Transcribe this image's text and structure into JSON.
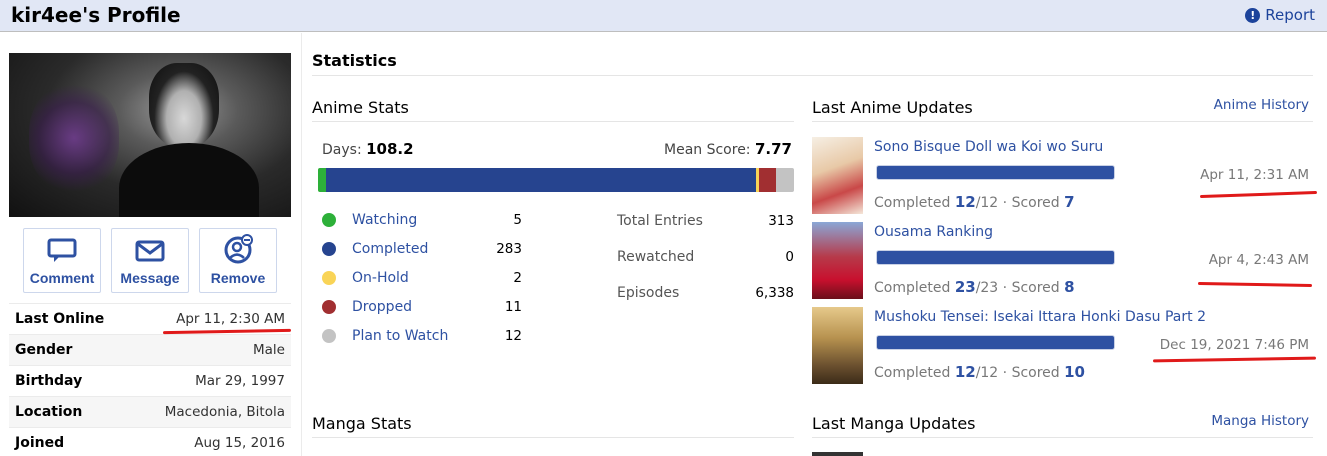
{
  "header": {
    "title": "kir4ee's Profile",
    "report_label": "Report"
  },
  "actions": [
    {
      "label": "Comment",
      "icon": "comment-icon"
    },
    {
      "label": "Message",
      "icon": "envelope-icon"
    },
    {
      "label": "Remove",
      "icon": "remove-friend-icon"
    }
  ],
  "info": [
    {
      "key": "Last Online",
      "value": "Apr 11, 2:30 AM"
    },
    {
      "key": "Gender",
      "value": "Male"
    },
    {
      "key": "Birthday",
      "value": "Mar 29, 1997"
    },
    {
      "key": "Location",
      "value": "Macedonia, Bitola"
    },
    {
      "key": "Joined",
      "value": "Aug 15, 2016"
    }
  ],
  "statistics": {
    "title": "Statistics",
    "anime_stats_title": "Anime Stats",
    "days_label": "Days:",
    "days_value": "108.2",
    "mean_label": "Mean Score:",
    "mean_value": "7.77",
    "legend": [
      {
        "name": "Watching",
        "count": "5",
        "color": "#2db039"
      },
      {
        "name": "Completed",
        "count": "283",
        "color": "#26448f"
      },
      {
        "name": "On-Hold",
        "count": "2",
        "color": "#f9d457"
      },
      {
        "name": "Dropped",
        "count": "11",
        "color": "#a12f31"
      },
      {
        "name": "Plan to Watch",
        "count": "12",
        "color": "#c3c3c3"
      }
    ],
    "totals": [
      {
        "key": "Total Entries",
        "value": "313"
      },
      {
        "key": "Rewatched",
        "value": "0"
      },
      {
        "key": "Episodes",
        "value": "6,338"
      }
    ],
    "manga_stats_title": "Manga Stats"
  },
  "updates": {
    "anime_title": "Last Anime Updates",
    "anime_history_label": "Anime History",
    "items": [
      {
        "title": "Sono Bisque Doll wa Koi wo Suru",
        "date": "Apr 11, 2:31 AM",
        "completed_label": "Completed",
        "progress": "12",
        "total": "/12",
        "scored_label": " · Scored",
        "score": "7"
      },
      {
        "title": "Ousama Ranking",
        "date": "Apr 4, 2:43 AM",
        "completed_label": "Completed",
        "progress": "23",
        "total": "/23",
        "scored_label": " · Scored",
        "score": "8"
      },
      {
        "title": "Mushoku Tensei: Isekai Ittara Honki Dasu Part 2",
        "date": "Dec 19, 2021 7:46 PM",
        "completed_label": "Completed",
        "progress": "12",
        "total": "/12",
        "scored_label": " · Scored",
        "score": "10"
      }
    ],
    "manga_title": "Last Manga Updates",
    "manga_history_label": "Manga History"
  }
}
